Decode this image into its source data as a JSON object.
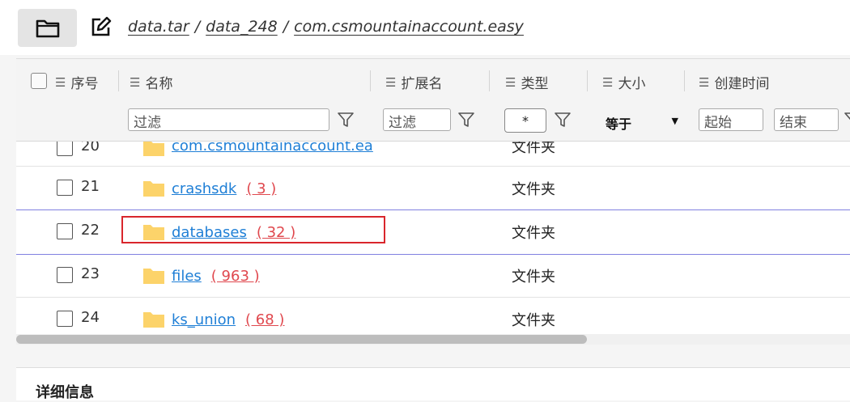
{
  "toolbar": {
    "folder_icon": "folder-icon",
    "edit_icon": "edit-icon",
    "breadcrumb": [
      "data.tar",
      "data_248",
      "com.csmountainaccount.easy"
    ],
    "separator": "/"
  },
  "columns": {
    "index": "序号",
    "name": "名称",
    "ext": "扩展名",
    "type": "类型",
    "size": "大小",
    "created": "创建时间"
  },
  "filters": {
    "name_placeholder": "过滤",
    "ext_placeholder": "过滤",
    "type_value": "*",
    "size_op": "等于",
    "created_start": "起始",
    "created_end": "结束"
  },
  "rows": [
    {
      "idx": "20",
      "name": "com.csmountainaccount.ea",
      "count": "",
      "type": "文件夹"
    },
    {
      "idx": "21",
      "name": "crashsdk",
      "count": "( 3 )",
      "type": "文件夹"
    },
    {
      "idx": "22",
      "name": "databases",
      "count": "( 32 )",
      "type": "文件夹"
    },
    {
      "idx": "23",
      "name": "files",
      "count": "( 963 )",
      "type": "文件夹"
    },
    {
      "idx": "24",
      "name": "ks_union",
      "count": "( 68 )",
      "type": "文件夹"
    }
  ],
  "detail": {
    "title": "详细信息"
  },
  "colors": {
    "link": "#1f7fd6",
    "count": "#e0484e",
    "highlight": "#d9262c",
    "folder": "#fcd36a"
  }
}
